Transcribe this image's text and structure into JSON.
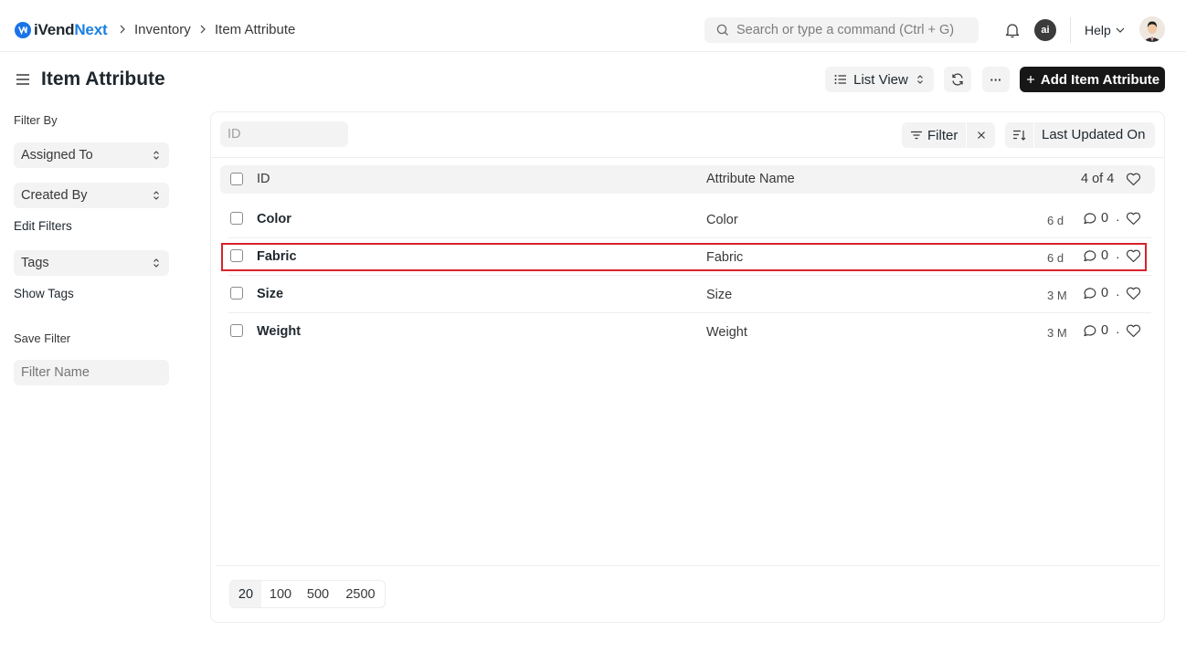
{
  "navbar": {
    "brand_prefix": "iVend",
    "brand_suffix": "Next",
    "breadcrumbs": [
      "Inventory",
      "Item Attribute"
    ],
    "search_placeholder": "Search or type a command (Ctrl + G)",
    "ai_label": "ai",
    "help_label": "Help"
  },
  "page": {
    "title": "Item Attribute",
    "view_label": "List View",
    "more_label": "···",
    "add_label": "Add Item Attribute"
  },
  "sidebar": {
    "filter_by": "Filter By",
    "assigned_to": "Assigned To",
    "created_by": "Created By",
    "edit_filters": "Edit Filters",
    "tags": "Tags",
    "show_tags": "Show Tags",
    "save_filter": "Save Filter",
    "filter_name_placeholder": "Filter Name"
  },
  "list": {
    "id_placeholder": "ID",
    "filter_label": "Filter",
    "sort_label": "Last Updated On",
    "columns": {
      "id": "ID",
      "name": "Attribute Name",
      "count": "4 of 4"
    },
    "rows": [
      {
        "id": "Color",
        "name": "Color",
        "time": "6 d",
        "comments": "0"
      },
      {
        "id": "Fabric",
        "name": "Fabric",
        "time": "6 d",
        "comments": "0"
      },
      {
        "id": "Size",
        "name": "Size",
        "time": "3 M",
        "comments": "0"
      },
      {
        "id": "Weight",
        "name": "Weight",
        "time": "3 M",
        "comments": "0"
      }
    ],
    "page_sizes": [
      "20",
      "100",
      "500",
      "2500"
    ]
  },
  "colors": {
    "accent": "#1a7fe0",
    "primary_button": "#171717",
    "highlight": "#d8232a"
  }
}
